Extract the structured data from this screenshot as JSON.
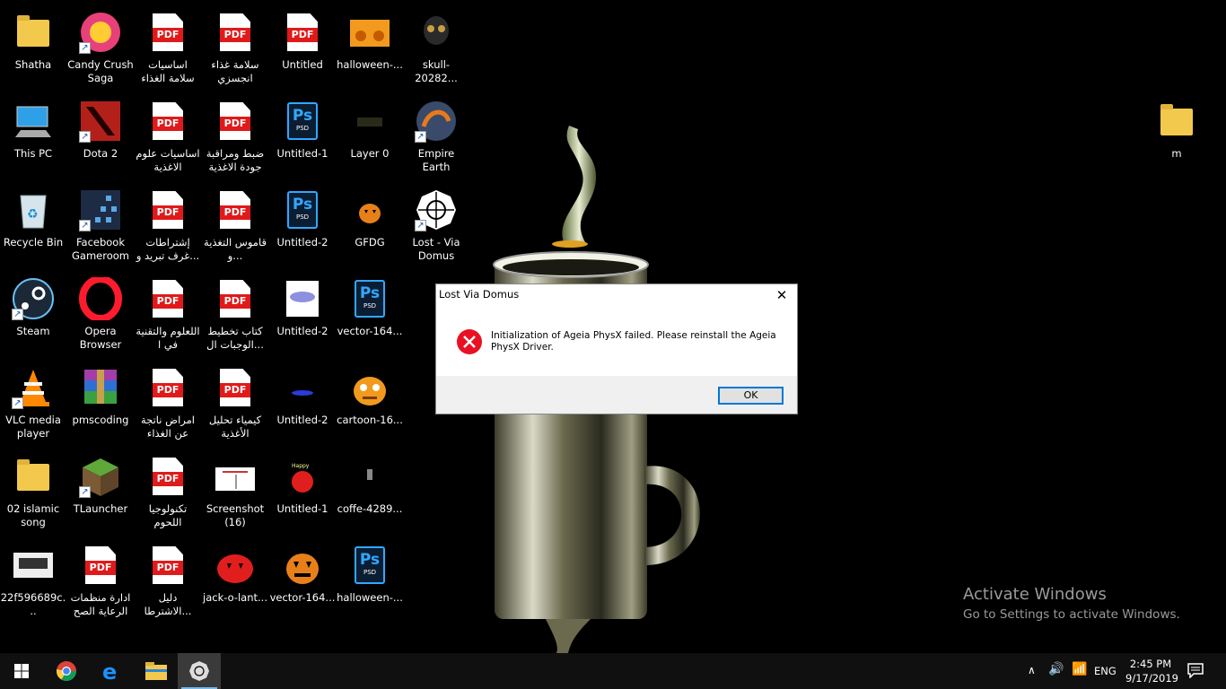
{
  "desktop": {
    "icons": [
      {
        "label": "Shatha"
      },
      {
        "label": "Candy Crush Saga"
      },
      {
        "label": "اساسيات سلامة الغذاء"
      },
      {
        "label": "سلامة غذاء انجسزي"
      },
      {
        "label": "Untitled"
      },
      {
        "label": "halloween-..."
      },
      {
        "label": "skull-20282..."
      },
      {
        "label": "This PC"
      },
      {
        "label": "Dota 2"
      },
      {
        "label": "اساسيات علوم الاغذية"
      },
      {
        "label": "ضبط ومراقبة جودة الاغذية"
      },
      {
        "label": "Untitled-1"
      },
      {
        "label": "Layer 0"
      },
      {
        "label": "Empire Earth"
      },
      {
        "label": "Recycle Bin"
      },
      {
        "label": "Facebook Gameroom"
      },
      {
        "label": "إشتراطات غرف تبريد و..."
      },
      {
        "label": "قاموس التغذية و..."
      },
      {
        "label": "Untitled-2"
      },
      {
        "label": "GFDG"
      },
      {
        "label": "Lost - Via Domus"
      },
      {
        "label": "Steam"
      },
      {
        "label": "Opera Browser"
      },
      {
        "label": "اللعلوم والتقنية في ا"
      },
      {
        "label": "كتاب تخطيط الوجبات ال..."
      },
      {
        "label": "Untitled-2"
      },
      {
        "label": "vector-164..."
      },
      {
        "label": "VLC media player"
      },
      {
        "label": "pmscoding"
      },
      {
        "label": "امراض ناتجة عن الغذاء"
      },
      {
        "label": "كيمياء تحليل الأغذية"
      },
      {
        "label": "Untitled-2"
      },
      {
        "label": "cartoon-16..."
      },
      {
        "label": "02 islamic song"
      },
      {
        "label": "TLauncher"
      },
      {
        "label": "تكنولوجيا اللحوم"
      },
      {
        "label": "Screenshot (16)"
      },
      {
        "label": "Untitled-1"
      },
      {
        "label": "coffe-4289..."
      },
      {
        "label": "22f596689c..."
      },
      {
        "label": "ادارة منظمات الرعاية الصح"
      },
      {
        "label": "دليل الاشترطا..."
      },
      {
        "label": "jack-o-lant..."
      },
      {
        "label": "vector-164..."
      },
      {
        "label": "halloween-..."
      },
      {
        "label": "m"
      }
    ]
  },
  "dialog": {
    "title": "Lost Via Domus",
    "close_glyph": "✕",
    "message": "Initialization of Ageia PhysX failed. Please reinstall the Ageia PhysX Driver.",
    "ok_label": "OK"
  },
  "watermark": {
    "title": "Activate Windows",
    "subtitle": "Go to Settings to activate Windows."
  },
  "taskbar": {
    "tray": {
      "chevron": "∧",
      "volume": "🔊",
      "wifi": "📶",
      "language": "ENG",
      "time": "2:45 PM",
      "date": "9/17/2019"
    }
  },
  "colors": {
    "accent": "#0078d7",
    "error_red": "#e81123",
    "pdf_red": "#e01a1a",
    "psd_blue": "#31a8ff"
  }
}
